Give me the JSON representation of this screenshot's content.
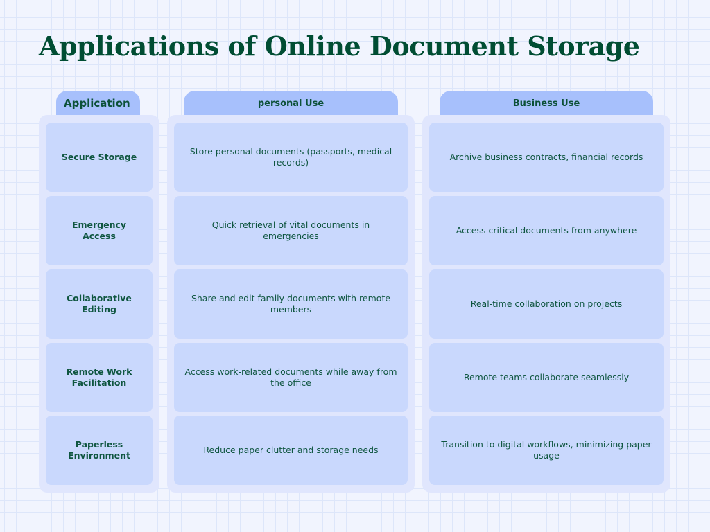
{
  "title": "Applications of Online Document Storage",
  "headers": {
    "application": "Application",
    "personal": "personal Use",
    "business": "Business Use"
  },
  "rows": [
    {
      "application": "Secure Storage",
      "personal": "Store personal documents (passports, medical records)",
      "business": "Archive business contracts, financial records"
    },
    {
      "application": "Emergency Access",
      "personal": "Quick retrieval of vital documents in emergencies",
      "business": "Access critical documents from anywhere"
    },
    {
      "application": "Collaborative Editing",
      "personal": "Share and edit family documents with remote members",
      "business": "Real-time collaboration on projects"
    },
    {
      "application": "Remote Work Facilitation",
      "personal": "Access work-related documents while away from the office",
      "business": "Remote teams collaborate seamlessly"
    },
    {
      "application": "Paperless Environment",
      "personal": "Reduce paper clutter and storage needs",
      "business": "Transition to digital workflows, minimizing paper usage"
    }
  ],
  "colors": {
    "background": "#f1f4fe",
    "title": "#004d33",
    "header": "#a7c0fc",
    "column": "#e0e6fd",
    "cell": "#c9d8fd",
    "text": "#0c5138"
  }
}
